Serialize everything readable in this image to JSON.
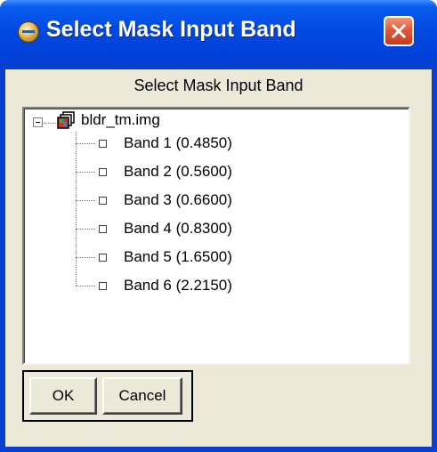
{
  "window": {
    "title": "Select Mask Input Band"
  },
  "dialog": {
    "heading": "Select Mask Input Band",
    "tree": {
      "root": {
        "label": "bldr_tm.img",
        "expanded": true,
        "expander_symbol": "−"
      },
      "bands": [
        {
          "label": "Band 1 (0.4850)"
        },
        {
          "label": "Band 2 (0.5600)"
        },
        {
          "label": "Band 3 (0.6600)"
        },
        {
          "label": "Band 4 (0.8300)"
        },
        {
          "label": "Band 5 (1.6500)"
        },
        {
          "label": "Band 6 (2.2150)"
        }
      ]
    },
    "buttons": {
      "ok_label": "OK",
      "cancel_label": "Cancel"
    }
  },
  "colors": {
    "titlebar": "#0a3fd0",
    "close_button": "#e2573a",
    "client_background": "#ece9d8",
    "tree_background": "#ffffff"
  },
  "icons": {
    "app": "app-globe-icon",
    "close": "close-icon",
    "root": "image-file-icon",
    "band": "band-node-icon"
  }
}
